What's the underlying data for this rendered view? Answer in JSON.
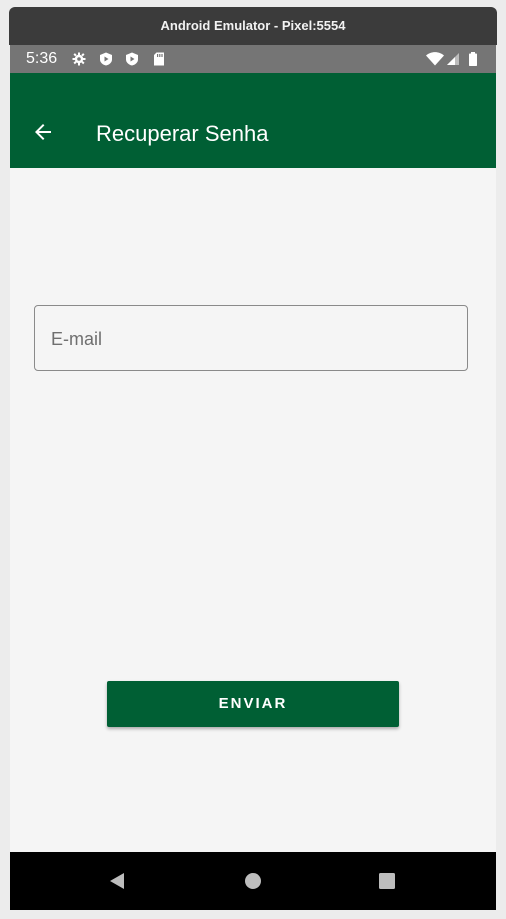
{
  "window": {
    "title": "Android Emulator - Pixel:5554"
  },
  "status_bar": {
    "time": "5:36",
    "icons_left": [
      "gear-icon",
      "play-protect-icon",
      "play-protect-icon",
      "sd-card-icon"
    ],
    "icons_right": [
      "wifi-icon",
      "cellular-signal-icon",
      "battery-icon"
    ]
  },
  "app_bar": {
    "title": "Recuperar Senha",
    "back_icon": "arrow-back-icon",
    "background": "#005f34"
  },
  "form": {
    "email_placeholder": "E-mail",
    "email_value": ""
  },
  "actions": {
    "send_label": "ENVIAR",
    "send_color": "#005f34"
  },
  "nav_bar": {
    "icons": [
      "back-triangle-icon",
      "home-circle-icon",
      "recents-square-icon"
    ]
  }
}
